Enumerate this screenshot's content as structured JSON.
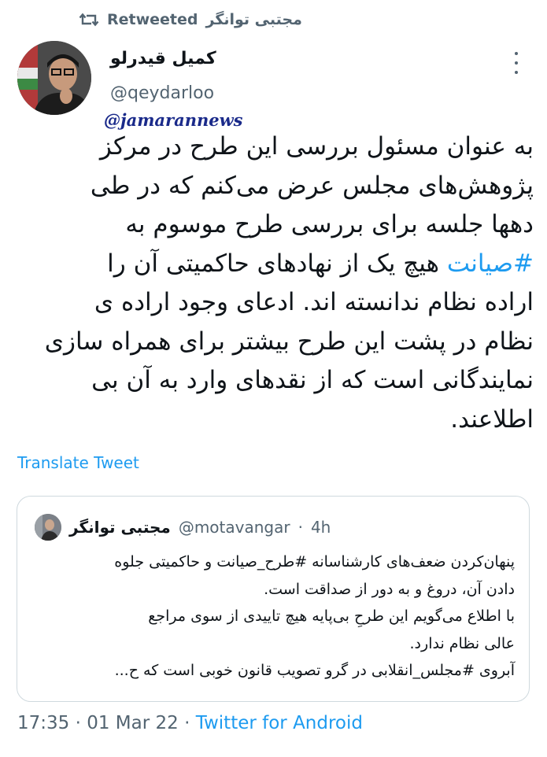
{
  "retweet": {
    "user": "مجتبی توانگر",
    "label": "Retweeted"
  },
  "author": {
    "name": "کمیل قیدرلو",
    "handle": "@qeydarloo"
  },
  "watermark": "@jamarannews",
  "tweet": {
    "lines": [
      "به عنوان مسئول بررسی این طرح در مرکز",
      "پژوهش‌های مجلس عرض می‌کنم که در طی",
      "دهها جلسه برای بررسی طرح موسوم به",
      {
        "hashtag": "#صیانت",
        "rest": " هیچ یک از نهادهای حاکمیتی آن را"
      },
      "اراده نظام ندانسته اند. ادعای وجود اراده ی",
      "نظام در پشت این طرح بیشتر برای همراه سازی",
      "نمایندگانی است که از نقدهای وارد به آن بی",
      "اطلاعند."
    ]
  },
  "translate_label": "Translate Tweet",
  "quote": {
    "name": "مجتبی توانگر",
    "handle": "@motavangar",
    "separator": "·",
    "time": "4h",
    "lines": [
      "پنهان‌کردن ضعف‌های کارشناسانه #طرح_صیانت و حاکمیتی جلوه",
      "دادن آن، دروغ و به دور از صداقت است.",
      "با اطلاع می‌گویم این طرحِ بی‌پایه هیچ تاییدی از سوی مراجع",
      "عالی نظام ندارد.",
      "آبروی #مجلس_انقلابی در گرو تصویب قانون خوبی است که ح..."
    ]
  },
  "meta": {
    "time": "17:35",
    "separator": "·",
    "date": "01 Mar 22",
    "source": "Twitter for Android"
  },
  "colors": {
    "accent": "#1d9bf0",
    "secondary_text": "#536471",
    "border": "#cfd9de"
  },
  "icons": {
    "retweet": "retweet-icon",
    "more": "more-options-icon"
  }
}
